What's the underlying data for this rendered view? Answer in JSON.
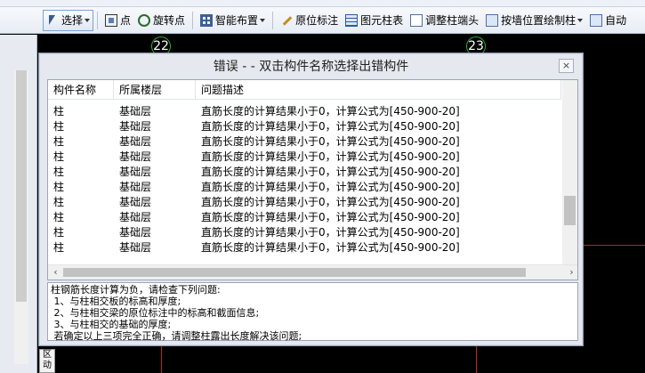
{
  "toolbar": {
    "select_label": "选择",
    "point_label": "点",
    "rotate_point_label": "旋转点",
    "smart_layout_label": "智能布置",
    "original_mark_label": "原位标注",
    "element_table_label": "图元柱表",
    "adjust_column_end_label": "调整柱端头",
    "draw_by_wall_label": "按墙位置绘制柱",
    "auto_label": "自动"
  },
  "canvas": {
    "axis_22": "22",
    "axis_23": "23",
    "bottom_button_label": "区动"
  },
  "dialog": {
    "title": "错误 - - 双击构件名称选择出错构件",
    "close_label": "×",
    "columns": [
      "构件名称",
      "所属楼层",
      "问题描述"
    ],
    "rows": [
      {
        "name": "柱",
        "floor": "基础层",
        "desc": "直筋长度的计算结果小于0，计算公式为[450-900-20]"
      },
      {
        "name": "柱",
        "floor": "基础层",
        "desc": "直筋长度的计算结果小于0，计算公式为[450-900-20]"
      },
      {
        "name": "柱",
        "floor": "基础层",
        "desc": "直筋长度的计算结果小于0，计算公式为[450-900-20]"
      },
      {
        "name": "柱",
        "floor": "基础层",
        "desc": "直筋长度的计算结果小于0，计算公式为[450-900-20]"
      },
      {
        "name": "柱",
        "floor": "基础层",
        "desc": "直筋长度的计算结果小于0，计算公式为[450-900-20]"
      },
      {
        "name": "柱",
        "floor": "基础层",
        "desc": "直筋长度的计算结果小于0，计算公式为[450-900-20]"
      },
      {
        "name": "柱",
        "floor": "基础层",
        "desc": "直筋长度的计算结果小于0，计算公式为[450-900-20]"
      },
      {
        "name": "柱",
        "floor": "基础层",
        "desc": "直筋长度的计算结果小于0，计算公式为[450-900-20]"
      },
      {
        "name": "柱",
        "floor": "基础层",
        "desc": "直筋长度的计算结果小于0，计算公式为[450-900-20]"
      },
      {
        "name": "柱",
        "floor": "基础层",
        "desc": "直筋长度的计算结果小于0，计算公式为[450-900-20]"
      }
    ],
    "hint_lines": [
      "柱钢筋长度计算为负，请检查下列问题:",
      " 1、与柱相交板的标高和厚度;",
      " 2、与柱相交梁的原位标注中的标高和截面信息;",
      " 3、与柱相交的基础的厚度;",
      " 若确定以上三项完全正确，请调整柱露出长度解决该问题;"
    ]
  },
  "colors": {
    "canvas_bg": "#000000",
    "grid_line": "#c62020",
    "axis_bubble": "#2fae2f",
    "dialog_bg": "#e5e8ee"
  }
}
